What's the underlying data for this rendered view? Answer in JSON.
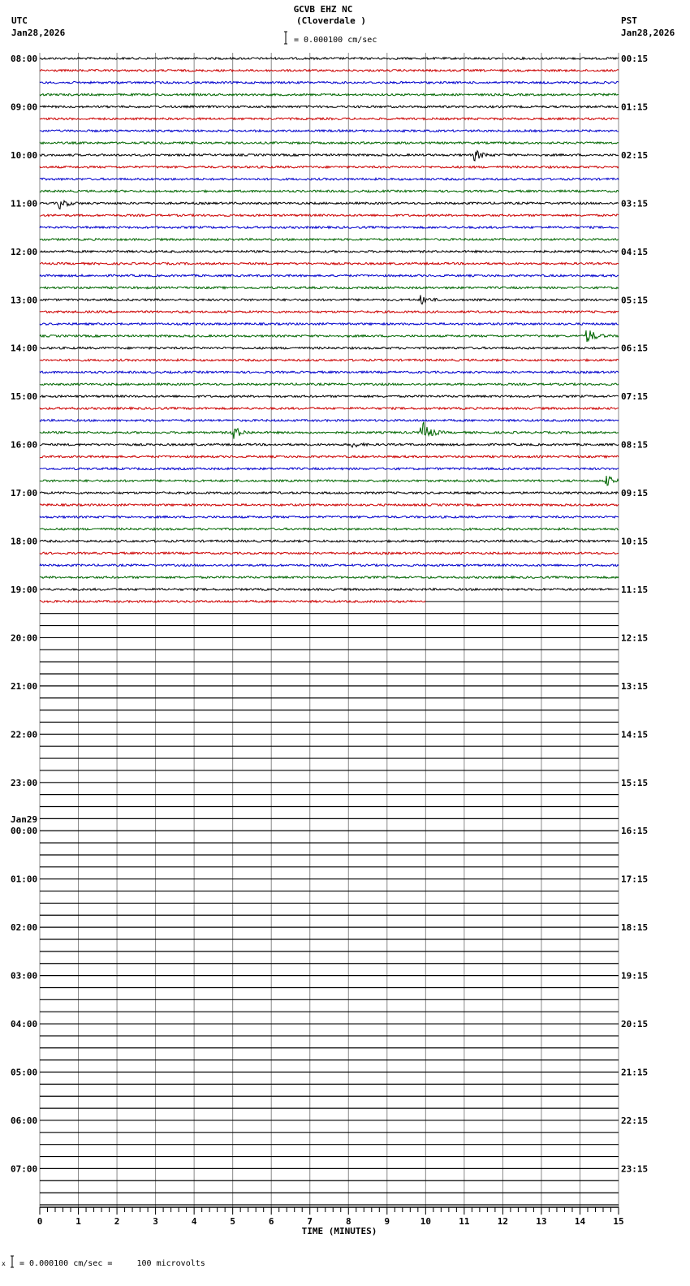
{
  "header": {
    "station": "GCVB EHZ NC",
    "location": "(Cloverdale )",
    "left_tz": "UTC",
    "left_date": "Jan28,2026",
    "right_tz": "PST",
    "right_date": "Jan28,2026",
    "scale_text": "= 0.000100 cm/sec"
  },
  "footer": {
    "scale_text": "= 0.000100 cm/sec =     100 microvolts",
    "mark": "x"
  },
  "chart_data": {
    "type": "line",
    "title": "GCVB EHZ NC (Cloverdale )",
    "xlabel": "TIME (MINUTES)",
    "xlim": [
      0,
      15
    ],
    "x_ticks": [
      "0",
      "1",
      "2",
      "3",
      "4",
      "5",
      "6",
      "7",
      "8",
      "9",
      "10",
      "11",
      "12",
      "13",
      "14",
      "15"
    ],
    "rows_total": 96,
    "rows_per_hour": 4,
    "trace_colors": [
      "#000000",
      "#cc0000",
      "#0000cc",
      "#006600"
    ],
    "rows_with_data": 46,
    "last_row_end_minute": 10,
    "utc_labels": [
      "08:00",
      "09:00",
      "10:00",
      "11:00",
      "12:00",
      "13:00",
      "14:00",
      "15:00",
      "16:00",
      "17:00",
      "18:00",
      "19:00",
      "20:00",
      "21:00",
      "22:00",
      "23:00",
      "00:00",
      "01:00",
      "02:00",
      "03:00",
      "04:00",
      "05:00",
      "06:00",
      "07:00"
    ],
    "date_change_label": "Jan29",
    "pst_labels": [
      "00:15",
      "01:15",
      "02:15",
      "03:15",
      "04:15",
      "05:15",
      "06:15",
      "07:15",
      "08:15",
      "09:15",
      "10:15",
      "11:15",
      "12:15",
      "13:15",
      "14:15",
      "15:15",
      "16:15",
      "17:15",
      "18:15",
      "19:15",
      "20:15",
      "21:15",
      "22:15",
      "23:15"
    ],
    "events": [
      {
        "row": 8,
        "minute": 11.3,
        "amp": 6
      },
      {
        "row": 12,
        "minute": 0.5,
        "amp": 7
      },
      {
        "row": 20,
        "minute": 9.9,
        "amp": 5
      },
      {
        "row": 23,
        "minute": 14.2,
        "amp": 9
      },
      {
        "row": 31,
        "minute": 5.0,
        "amp": 9
      },
      {
        "row": 31,
        "minute": 9.9,
        "amp": 16
      },
      {
        "row": 32,
        "minute": 8.1,
        "amp": 3
      },
      {
        "row": 35,
        "minute": 14.7,
        "amp": 6
      }
    ]
  }
}
